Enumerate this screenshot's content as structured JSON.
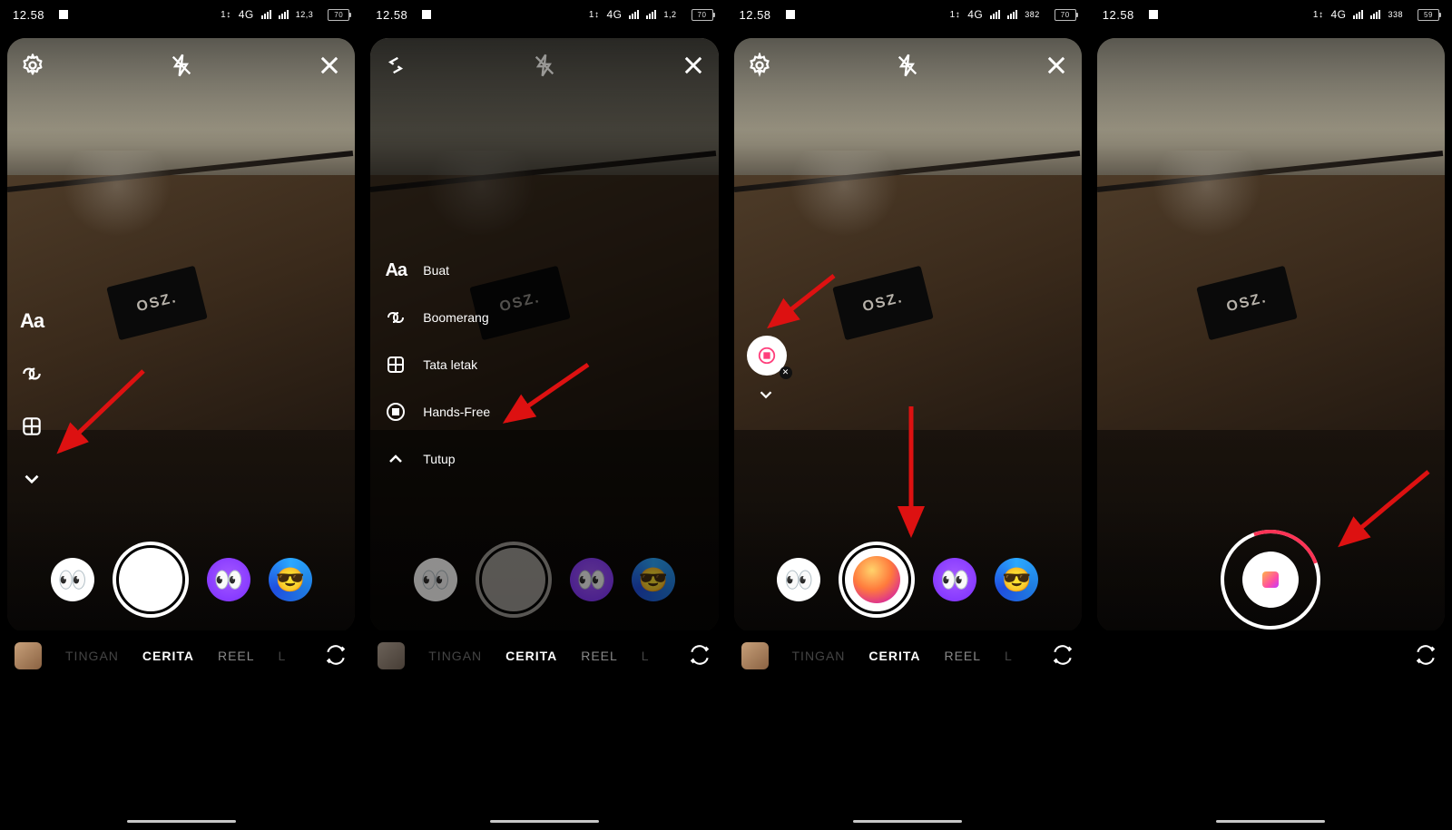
{
  "status": {
    "time": "12.58",
    "net": "4G",
    "battery": "70"
  },
  "screens": [
    {
      "speed": "12,3",
      "battery": "70"
    },
    {
      "speed": "1,2",
      "battery": "70"
    },
    {
      "speed": "382",
      "battery": "70"
    },
    {
      "speed": "338",
      "battery": "59"
    }
  ],
  "sticker_text": "OSZ.",
  "menu": {
    "buat": "Buat",
    "boomerang": "Boomerang",
    "tataletak": "Tata letak",
    "handsfree": "Hands-Free",
    "tutup": "Tutup"
  },
  "tabs": {
    "tingan": "TINGAN",
    "cerita": "CERITA",
    "reel": "REEL",
    "l": "L"
  }
}
